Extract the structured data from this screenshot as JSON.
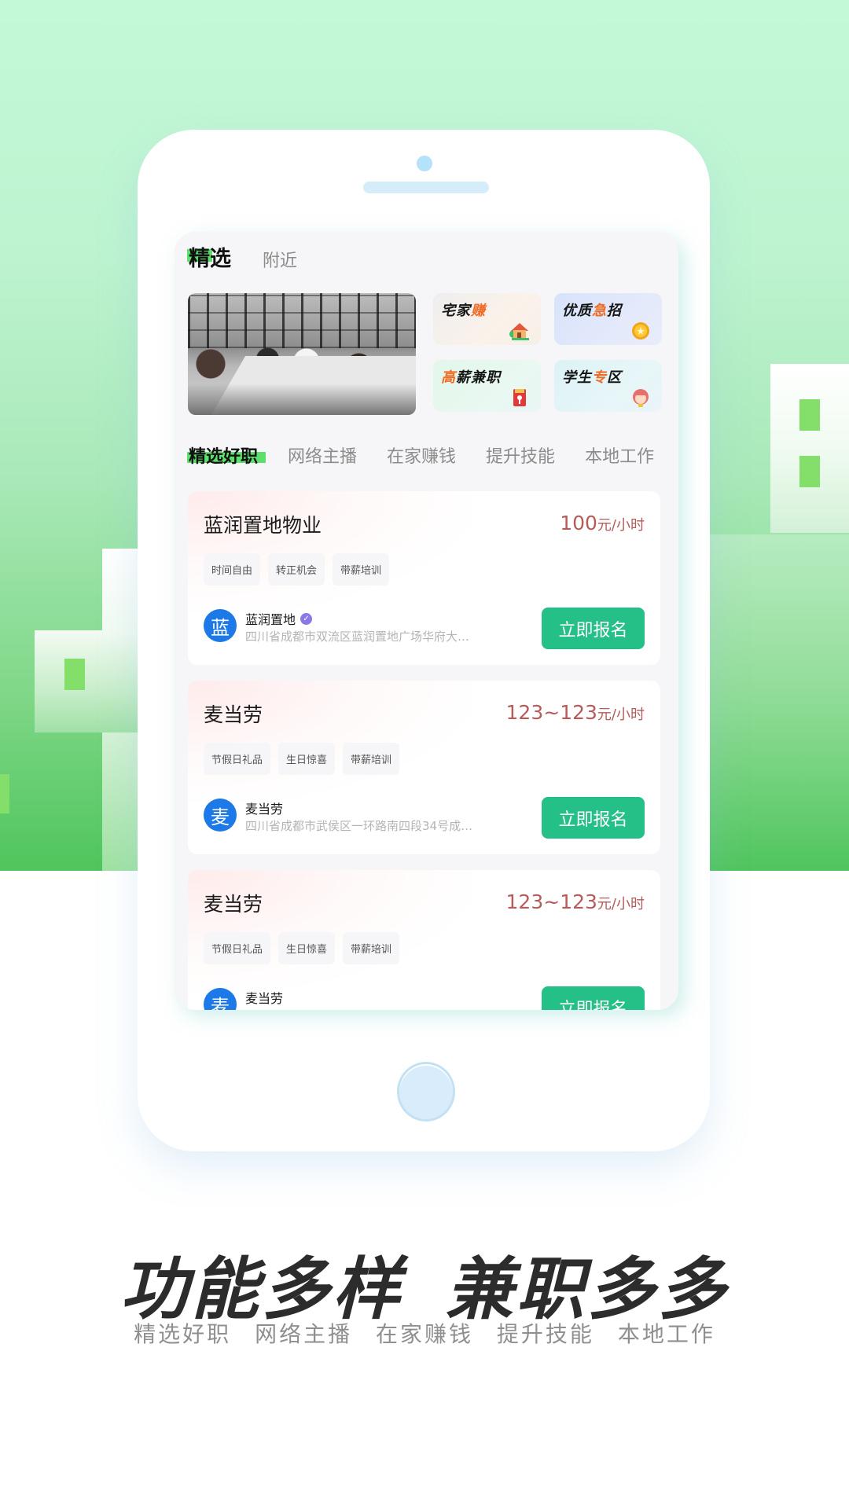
{
  "screen": {
    "top_tabs": [
      {
        "label": "精选",
        "active": true
      },
      {
        "label": "附近",
        "active": false
      }
    ],
    "banner": {
      "alt": "office meeting photo"
    },
    "feature_tiles": [
      {
        "label_main": "宅家",
        "label_accent": "赚",
        "icon": "house-icon"
      },
      {
        "label_main": "优质",
        "label_accent": "急",
        "label_tail": "招",
        "icon": "medal-icon"
      },
      {
        "label_accent": "高",
        "label_main": "薪兼职",
        "icon": "red-envelope-icon"
      },
      {
        "label_main": "学生",
        "label_accent": "专",
        "label_tail": "区",
        "icon": "student-girl-icon"
      }
    ],
    "category_tabs": [
      "精选好职",
      "网络主播",
      "在家赚钱",
      "提升技能",
      "本地工作"
    ],
    "jobs": [
      {
        "title": "蓝润置地物业",
        "salary_amount": "100",
        "salary_unit": "元/小时",
        "tags": [
          "时间自由",
          "转正机会",
          "带薪培训"
        ],
        "avatar_char": "蓝",
        "company": "蓝润置地",
        "verified": true,
        "address": "四川省成都市双流区蓝润置地广场华府大…",
        "apply_label": "立即报名"
      },
      {
        "title": "麦当劳",
        "salary_amount": "123~123",
        "salary_unit": "元/小时",
        "tags": [
          "节假日礼品",
          "生日惊喜",
          "带薪培训"
        ],
        "avatar_char": "麦",
        "company": "麦当劳",
        "verified": false,
        "address": "四川省成都市武侯区一环路南四段34号成…",
        "apply_label": "立即报名"
      },
      {
        "title": "麦当劳",
        "salary_amount": "123~123",
        "salary_unit": "元/小时",
        "tags": [
          "节假日礼品",
          "生日惊喜",
          "带薪培训"
        ],
        "avatar_char": "麦",
        "company": "麦当劳",
        "verified": false,
        "address": "",
        "apply_label": "立即报名"
      }
    ]
  },
  "promo": {
    "headline_left": "功能多样",
    "headline_right": "兼职多多",
    "features": [
      "精选好职",
      "网络主播",
      "在家赚钱",
      "提升技能",
      "本地工作"
    ]
  },
  "colors": {
    "accent_green": "#25c087",
    "highlight_green": "#5ce06c",
    "salary_red": "#b65a5a",
    "avatar_blue": "#1d78e8",
    "tile_accent_orange": "#f06a23",
    "bg_green_top": "#c4f9d8",
    "bg_green_bottom": "#4fc55c"
  }
}
